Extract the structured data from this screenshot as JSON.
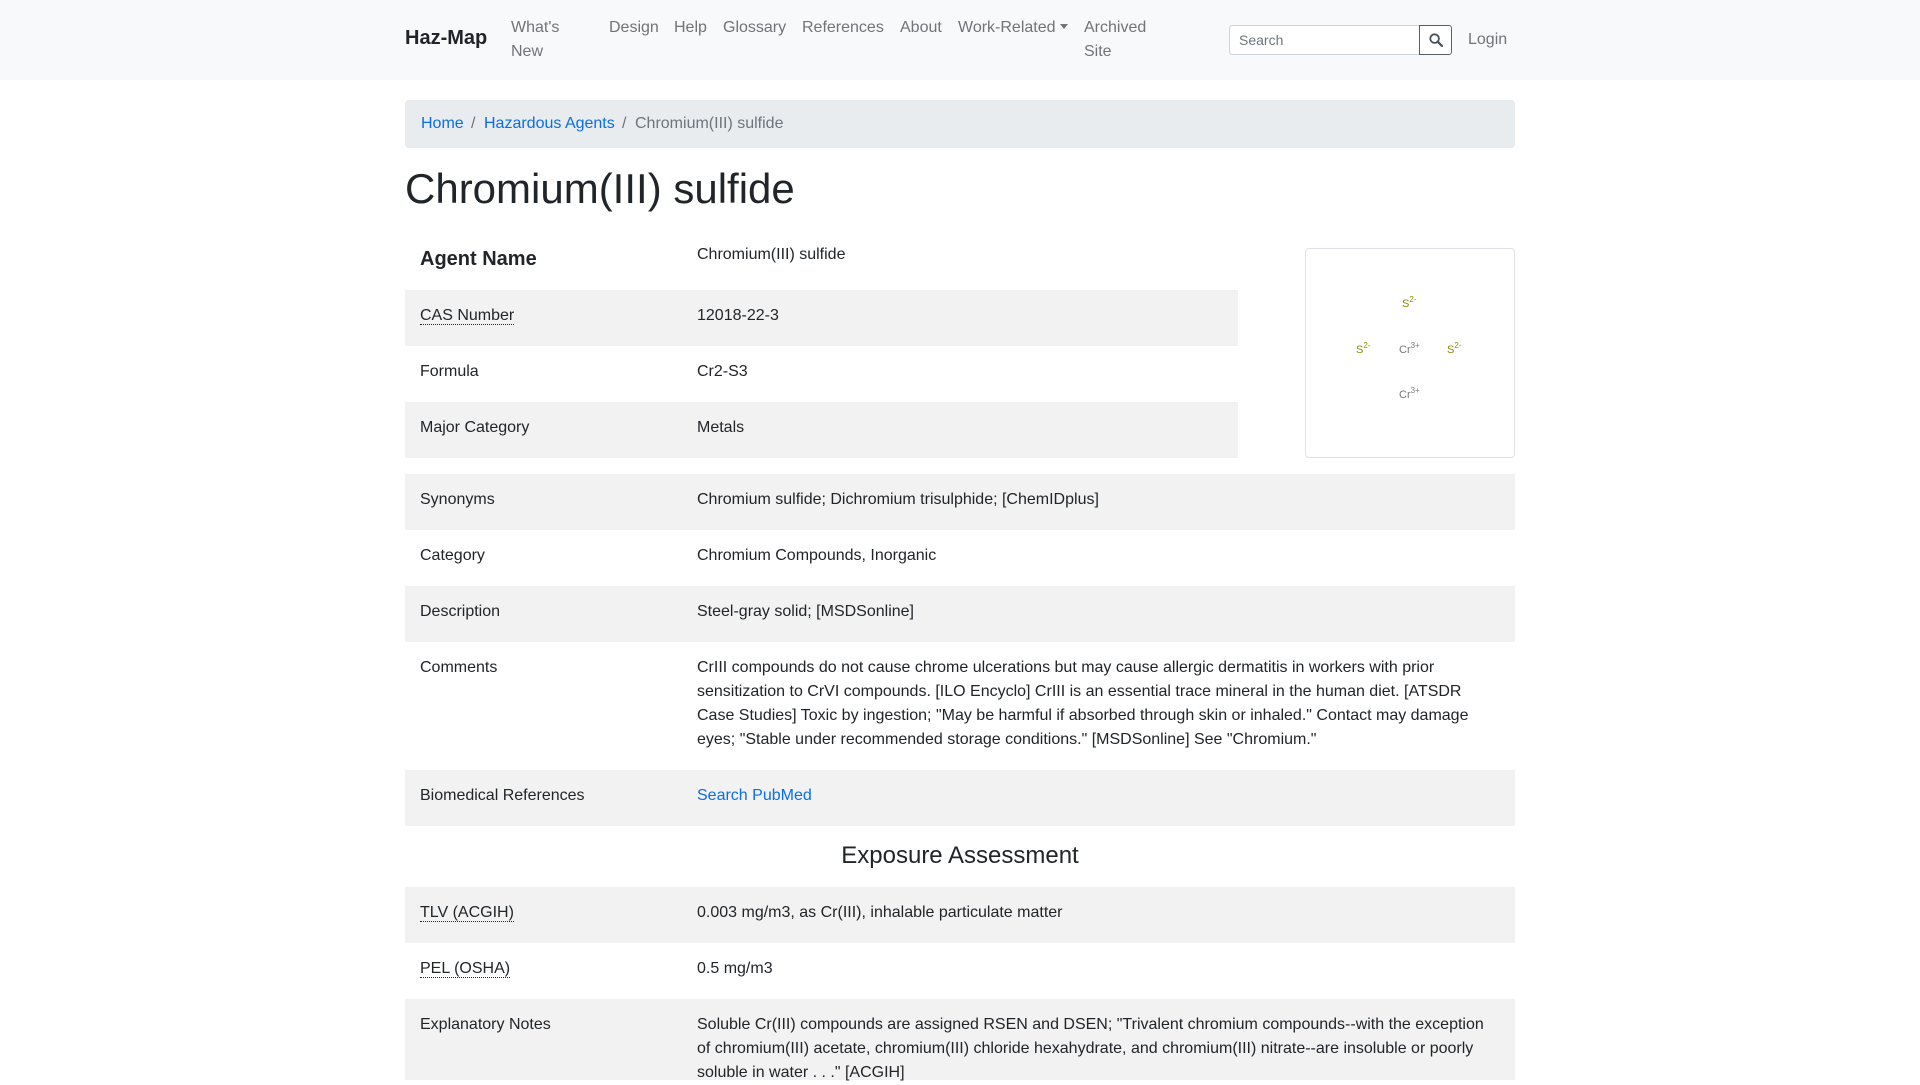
{
  "nav": {
    "brand": "Haz-Map",
    "whats_new_line1": "What's",
    "whats_new_line2": "New",
    "design": "Design",
    "help": "Help",
    "glossary": "Glossary",
    "references": "References",
    "about": "About",
    "work_related": "Work-Related",
    "archived_line1": "Archived",
    "archived_line2": "Site",
    "search_placeholder": "Search",
    "login": "Login"
  },
  "breadcrumb": {
    "home": "Home",
    "sep": "/",
    "hazardous_agents": "Hazardous Agents",
    "current": "Chromium(III) sulfide"
  },
  "page_title": "Chromium(III) sulfide",
  "structure": {
    "ion_s": "S",
    "charge_s": "2-",
    "ion_cr": "Cr",
    "charge_cr": "3+"
  },
  "fields": {
    "agent_name_label": "Agent Name",
    "agent_name": "Chromium(III) sulfide",
    "cas_label": "CAS Number",
    "cas": "12018-22-3",
    "formula_label": "Formula",
    "formula": "Cr2-S3",
    "major_category_label": "Major Category",
    "major_category": "Metals",
    "synonyms_label": "Synonyms",
    "synonyms": "Chromium sulfide; Dichromium trisulphide; [ChemIDplus]",
    "category_label": "Category",
    "category": "Chromium Compounds, Inorganic",
    "description_label": "Description",
    "description": "Steel-gray solid; [MSDSonline]",
    "comments_label": "Comments",
    "comments": "CrIII compounds do not cause chrome ulcerations but may cause allergic dermatitis in workers with prior sensitization to CrVI compounds. [ILO Encyclo] CrIII is an essential trace mineral in the human diet. [ATSDR Case Studies] Toxic by ingestion; \"May be harmful if absorbed through skin or inhaled.\" Contact may damage eyes; \"Stable under recommended storage conditions.\" [MSDSonline] See \"Chromium.\"",
    "biomed_label": "Biomedical References",
    "biomed_link": "Search PubMed"
  },
  "exposure": {
    "heading": "Exposure Assessment",
    "tlv_label": "TLV (ACGIH)",
    "tlv": "0.003 mg/m3, as Cr(III), inhalable particulate matter",
    "pel_label": "PEL (OSHA)",
    "pel": "0.5 mg/m3",
    "notes_label": "Explanatory Notes",
    "notes": "Soluble Cr(III) compounds are assigned RSEN and DSEN; \"Trivalent chromium compounds--with the exception of chromium(III) acetate, chromium(III) chloride hexahydrate, and chromium(III) nitrate--are insoluble or poorly soluble in water . . .\" [ACGIH]"
  },
  "colors": {
    "link": "#0a6ee8",
    "row_shade": "#f2f2f2",
    "sulfur": "#8b8b00",
    "chromium": "#777777"
  },
  "icons": {
    "search_button": "search-icon",
    "dropdown": "chevron-down-icon"
  }
}
